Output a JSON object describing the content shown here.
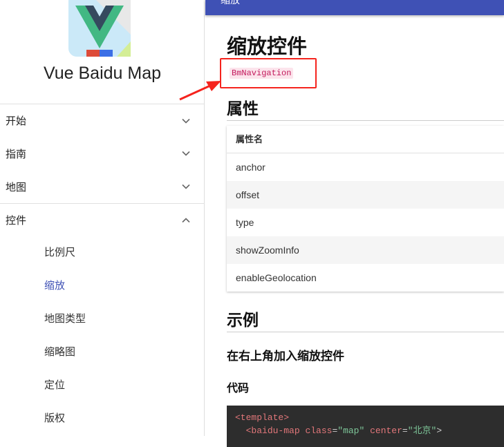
{
  "sidebar": {
    "brand": "Vue Baidu Map",
    "groups": [
      {
        "label": "开始",
        "expanded": false
      },
      {
        "label": "指南",
        "expanded": false
      },
      {
        "label": "地图",
        "expanded": false
      },
      {
        "label": "控件",
        "expanded": true,
        "items": [
          "比例尺",
          "缩放",
          "地图类型",
          "缩略图",
          "定位",
          "版权"
        ],
        "active": "缩放"
      }
    ]
  },
  "topbar": {
    "title": "缩放"
  },
  "main": {
    "title": "缩放控件",
    "component": "BmNavigation",
    "props_heading": "属性",
    "table": {
      "header": "属性名",
      "rows": [
        "anchor",
        "offset",
        "type",
        "showZoomInfo",
        "enableGeolocation"
      ]
    },
    "example_heading": "示例",
    "example_title": "在右上角加入缩放控件",
    "code_heading": "代码",
    "code": {
      "line1_tag": "<template>",
      "line2_open": "<baidu-map",
      "attr1": "class",
      "eq": "=",
      "val1": "\"map\"",
      "attr2": "center",
      "val2": "\"北京\"",
      "close": ">"
    }
  },
  "colors": {
    "primary": "#3f51b5",
    "highlight": "#f5231d"
  }
}
